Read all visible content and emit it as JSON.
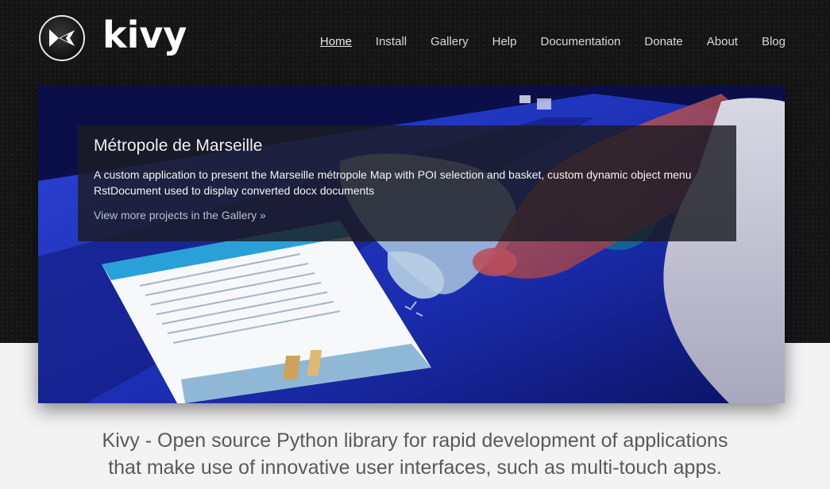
{
  "header": {
    "logo_text": "kivy",
    "logo_icon": "kivy-logo-icon"
  },
  "nav": {
    "items": [
      {
        "label": "Home",
        "active": true
      },
      {
        "label": "Install",
        "active": false
      },
      {
        "label": "Gallery",
        "active": false
      },
      {
        "label": "Help",
        "active": false
      },
      {
        "label": "Documentation",
        "active": false
      },
      {
        "label": "Donate",
        "active": false
      },
      {
        "label": "About",
        "active": false
      },
      {
        "label": "Blog",
        "active": false
      }
    ]
  },
  "hero": {
    "title": "Métropole de Marseille",
    "description": "A custom application to present the Marseille métropole Map with POI selection and basket, custom dynamic object menu RstDocument used to display converted docx documents",
    "link_label": "View more projects in the Gallery »"
  },
  "tagline": {
    "line1": "Kivy - Open source Python library for rapid development of applications",
    "line2": "that make use of innovative user interfaces, such as multi-touch apps."
  },
  "colors": {
    "header_bg": "#151515",
    "page_bg": "#f3f3f3",
    "nav_text": "#d8d8d8",
    "tagline_text": "#5a5a5a",
    "hero_blue": "#1c2fb8"
  }
}
